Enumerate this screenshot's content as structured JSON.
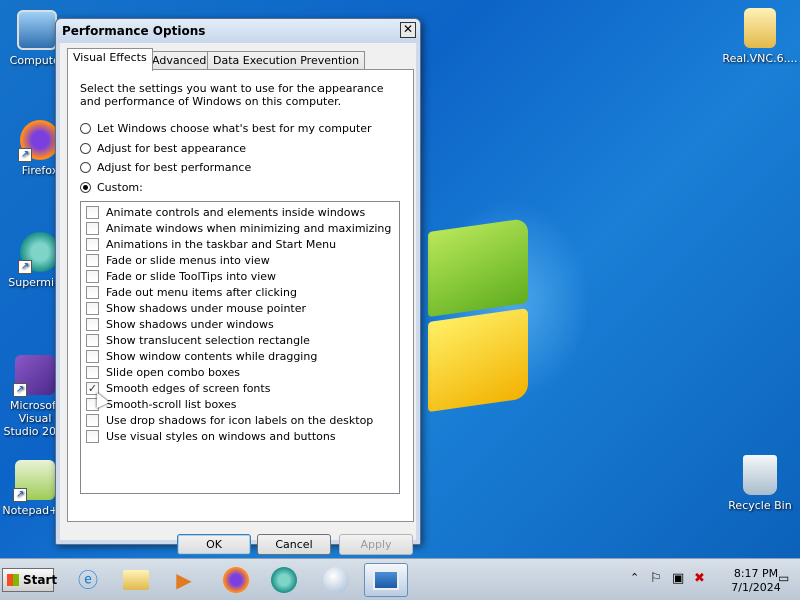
{
  "desktop": {
    "icons": [
      {
        "label": "Computer"
      },
      {
        "label": "Firefox"
      },
      {
        "label": "Supermium"
      },
      {
        "label": "Microsoft Visual Studio 20..."
      },
      {
        "label": "Notepad++"
      },
      {
        "label": "Real.VNC.6...."
      },
      {
        "label": "Recycle Bin"
      }
    ]
  },
  "dialog": {
    "title": "Performance Options",
    "close_glyph": "✕",
    "tabs": [
      "Visual Effects",
      "Advanced",
      "Data Execution Prevention"
    ],
    "description": "Select the settings you want to use for the appearance and performance of Windows on this computer.",
    "radios": [
      {
        "label": "Let Windows choose what's best for my computer",
        "selected": false
      },
      {
        "label": "Adjust for best appearance",
        "selected": false
      },
      {
        "label": "Adjust for best performance",
        "selected": false
      },
      {
        "label": "Custom:",
        "selected": true
      }
    ],
    "options": [
      {
        "label": "Animate controls and elements inside windows",
        "checked": false
      },
      {
        "label": "Animate windows when minimizing and maximizing",
        "checked": false
      },
      {
        "label": "Animations in the taskbar and Start Menu",
        "checked": false
      },
      {
        "label": "Fade or slide menus into view",
        "checked": false
      },
      {
        "label": "Fade or slide ToolTips into view",
        "checked": false
      },
      {
        "label": "Fade out menu items after clicking",
        "checked": false
      },
      {
        "label": "Show shadows under mouse pointer",
        "checked": false
      },
      {
        "label": "Show shadows under windows",
        "checked": false
      },
      {
        "label": "Show translucent selection rectangle",
        "checked": false
      },
      {
        "label": "Show window contents while dragging",
        "checked": false
      },
      {
        "label": "Slide open combo boxes",
        "checked": false
      },
      {
        "label": "Smooth edges of screen fonts",
        "checked": true
      },
      {
        "label": "Smooth-scroll list boxes",
        "checked": false
      },
      {
        "label": "Use drop shadows for icon labels on the desktop",
        "checked": false
      },
      {
        "label": "Use visual styles on windows and buttons",
        "checked": false
      }
    ],
    "buttons": {
      "ok": "OK",
      "cancel": "Cancel",
      "apply": "Apply"
    }
  },
  "taskbar": {
    "start_label": "Start",
    "apps": [
      "internet-explorer-icon",
      "windows-explorer-icon",
      "media-player-icon",
      "firefox-icon",
      "supermium-icon",
      "orb-icon",
      "performance-options-icon"
    ],
    "clock": {
      "time": "8:17 PM",
      "date": "7/1/2024"
    }
  }
}
